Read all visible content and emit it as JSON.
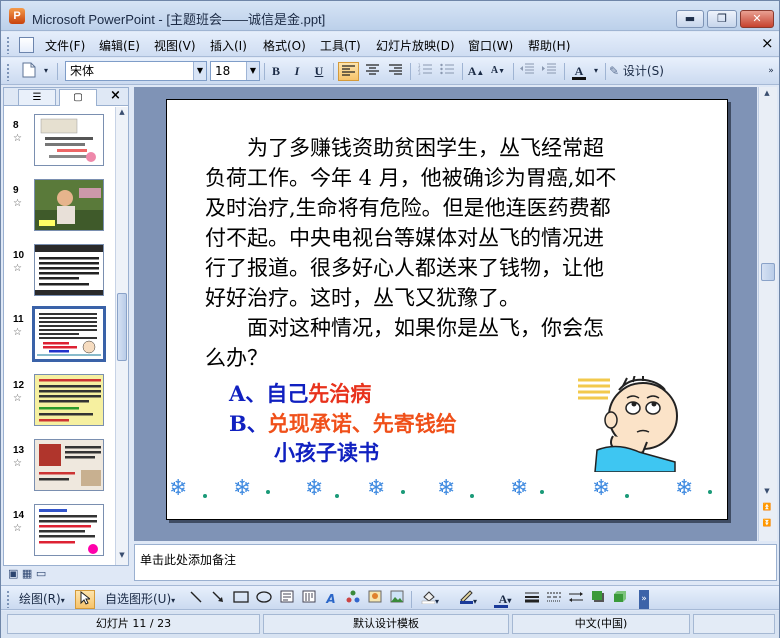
{
  "window": {
    "title": "Microsoft PowerPoint - [主题班会——诚信是金.ppt]",
    "app_icon_letter": "P",
    "minimize_glyph": "▬",
    "restore_glyph": "❐",
    "close_glyph": "✕"
  },
  "menu": {
    "items": [
      "文件(F)",
      "编辑(E)",
      "视图(V)",
      "插入(I)",
      "格式(O)",
      "工具(T)",
      "幻灯片放映(D)",
      "窗口(W)",
      "帮助(H)"
    ],
    "doc_close": "×"
  },
  "toolbar": {
    "font_name": "宋体",
    "font_size": "18",
    "bold": "B",
    "italic": "I",
    "underline": "U",
    "design_label": "设计(S)",
    "font_color_letter": "A"
  },
  "left_pane": {
    "tab_outline_icon": "outline-icon",
    "tab_slides_icon": "slides-icon",
    "close": "×",
    "slides": [
      {
        "num": "8"
      },
      {
        "num": "9"
      },
      {
        "num": "10"
      },
      {
        "num": "11"
      },
      {
        "num": "12"
      },
      {
        "num": "13"
      },
      {
        "num": "14"
      }
    ],
    "selected": "11",
    "star": "☆"
  },
  "slide": {
    "para1_lines": [
      "　　为了多赚钱资助贫困学生，丛飞经常超",
      "负荷工作。今年 4 月，他被确诊为胃癌,如不",
      "及时治疗,生命将有危险。但是他连医药费都",
      "付不起。中央电视台等媒体对丛飞的情况进",
      "行了报道。很多好心人都送来了钱物，让他",
      "好好治疗。这时，丛飞又犹豫了。"
    ],
    "para2_lines": [
      "　　面对这种情况，如果你是丛飞，你会怎",
      "么办？"
    ],
    "option_a_prefix": "A、自己",
    "option_a_highlight": "先治病",
    "option_b_prefix": "B、",
    "option_b_line1": "兑现承诺、先寄钱给",
    "option_b_line2": "小孩子读书",
    "colors": {
      "blue": "#1020c0",
      "red": "#e8321c",
      "orange_red": "#f0501a",
      "snowflake": "#3f8ae0",
      "dot": "#1a9a78"
    }
  },
  "notes": {
    "placeholder": "单击此处添加备注"
  },
  "drawbar": {
    "draw_label": "绘图(R)",
    "autoshape_label": "自选图形(U)"
  },
  "status": {
    "slide_counter": "幻灯片 11 / 23",
    "design_template": "默认设计模板",
    "language": "中文(中国)"
  }
}
